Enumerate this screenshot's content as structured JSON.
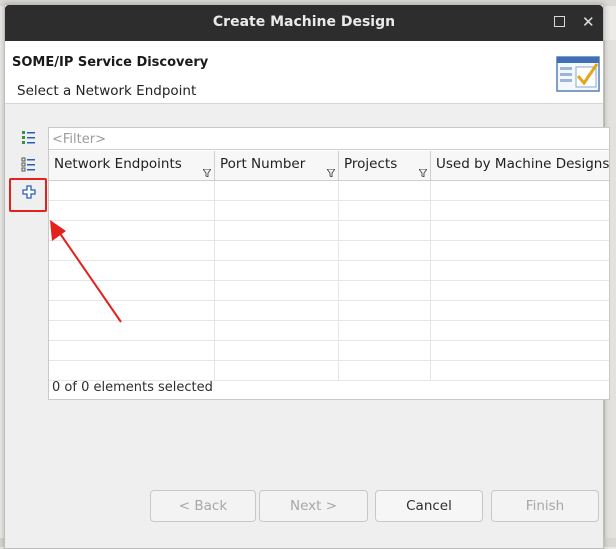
{
  "window": {
    "title": "Create Machine Design"
  },
  "header": {
    "title": "SOME/IP Service Discovery",
    "description": "Select a Network Endpoint"
  },
  "toolbar": {
    "icons": [
      "checklist-select-all-icon",
      "list-deselect-icon",
      "add-icon"
    ]
  },
  "table": {
    "filter_placeholder": "<Filter>",
    "columns": [
      "Network Endpoints",
      "Port Number",
      "Projects",
      "Used by Machine Designs"
    ],
    "rows": [],
    "status": "0 of 0 elements selected"
  },
  "buttons": {
    "back": "< Back",
    "next": "Next >",
    "cancel": "Cancel",
    "finish": "Finish"
  },
  "colors": {
    "titlebar": "#2d2d2d",
    "annotation": "#e3221c",
    "add_icon": "#2a5fb8"
  }
}
